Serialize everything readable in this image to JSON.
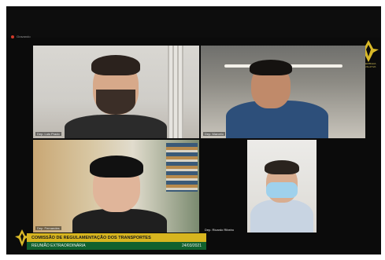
{
  "meeting": {
    "recording_label": "Gravando",
    "logo_caption": "ASSEMBLEIA LEGISLATIVA",
    "brand_gold": "#d7b51f",
    "brand_green": "#11612e"
  },
  "participants": [
    {
      "name": "Dep. Luis Prado"
    },
    {
      "name": "Dep. Marcelo"
    },
    {
      "name": "Dep. Fernandes"
    },
    {
      "name": "Dep. Ricardo Ribeiro"
    }
  ],
  "lower_third": {
    "title": "COMISSÃO DE REGULAMENTAÇÃO DOS TRANSPORTES",
    "subtitle": "REUNIÃO EXTRAORDINÁRIA",
    "date": "24/03/2021"
  }
}
